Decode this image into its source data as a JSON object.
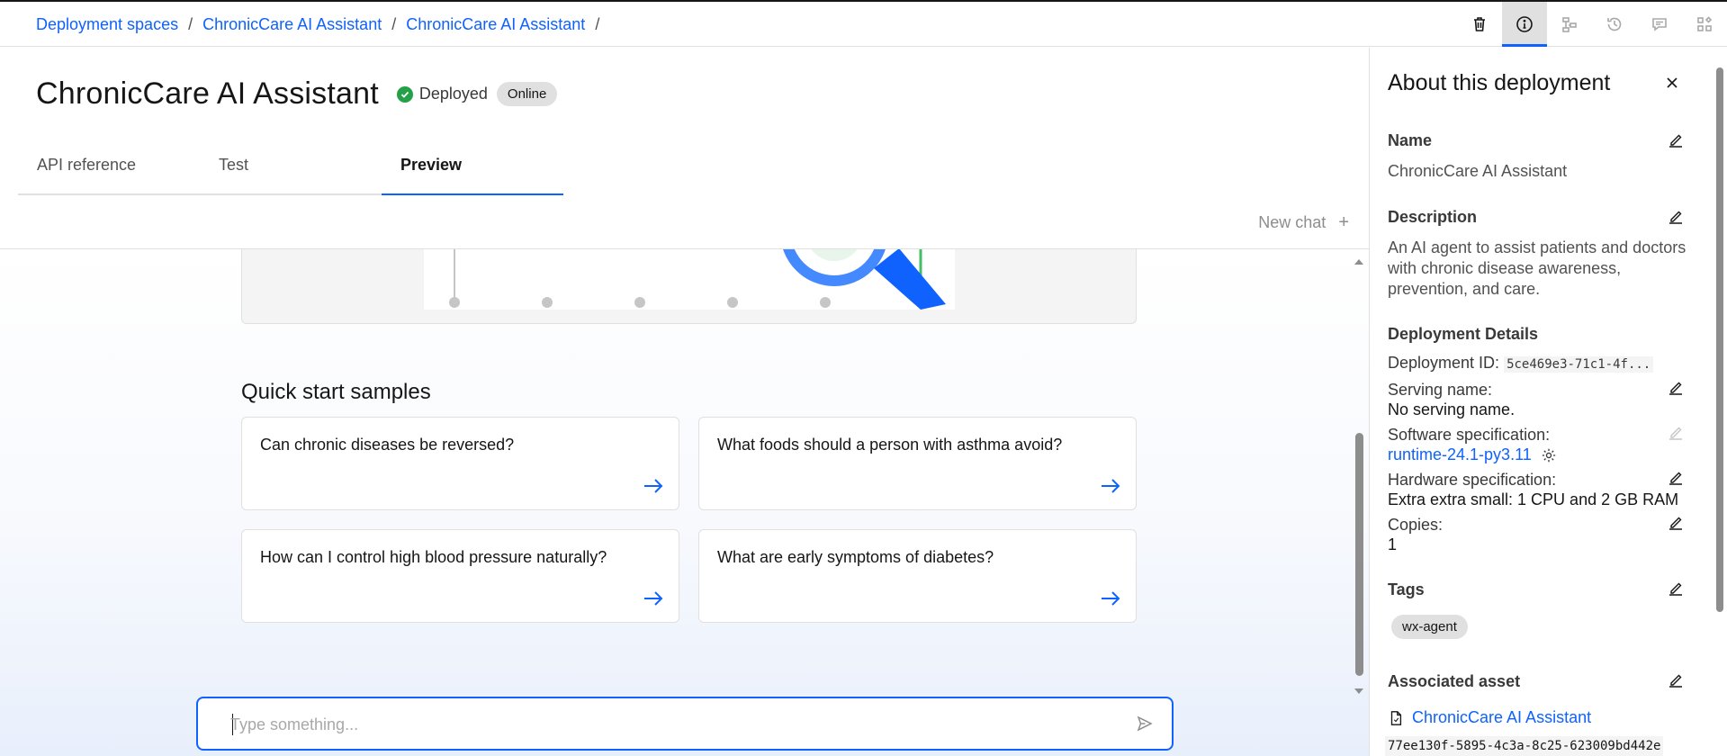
{
  "breadcrumb": {
    "items": [
      "Deployment spaces",
      "ChronicCare AI Assistant",
      "ChronicCare AI Assistant"
    ],
    "separator": "/"
  },
  "toolbar": {
    "icons": [
      "trash-icon",
      "info-icon",
      "flow-icon",
      "history-icon",
      "chat-icon",
      "apps-icon"
    ],
    "active": "info-icon"
  },
  "page": {
    "title": "ChronicCare AI Assistant",
    "status": "Deployed",
    "badge": "Online"
  },
  "tabs": [
    {
      "label": "API reference",
      "active": false
    },
    {
      "label": "Test",
      "active": false
    },
    {
      "label": "Preview",
      "active": true
    }
  ],
  "chat": {
    "new_chat_label": "New chat",
    "new_chat_icon": "+",
    "quick_start_title": "Quick start samples",
    "samples": [
      "Can chronic diseases be reversed?",
      "What foods should a person with asthma avoid?",
      "How can I control high blood pressure naturally?",
      "What are early symptoms of diabetes?"
    ],
    "input_placeholder": "Type something..."
  },
  "panel": {
    "title": "About this deployment",
    "name_label": "Name",
    "name_value": "ChronicCare AI Assistant",
    "description_label": "Description",
    "description_value": "An AI agent to assist patients and doctors with chronic disease awareness, prevention, and care.",
    "details_label": "Deployment Details",
    "deployment_id_label": "Deployment ID:",
    "deployment_id_value": "5ce469e3-71c1-4f...",
    "serving_name_label": "Serving name:",
    "serving_name_value": "No serving name.",
    "software_spec_label": "Software specification:",
    "software_spec_value": "runtime-24.1-py3.11",
    "hardware_spec_label": "Hardware specification:",
    "hardware_spec_value": "Extra extra small: 1 CPU and 2 GB RAM",
    "copies_label": "Copies:",
    "copies_value": "1",
    "tags_label": "Tags",
    "tags": [
      "wx-agent"
    ],
    "asset_label": "Associated asset",
    "asset_name": "ChronicCare AI Assistant",
    "asset_id": "77ee130f-5895-4c3a-8c25-623009bd442e"
  },
  "colors": {
    "accent": "#0f62fe",
    "success": "#24a148",
    "text": "#161616"
  }
}
